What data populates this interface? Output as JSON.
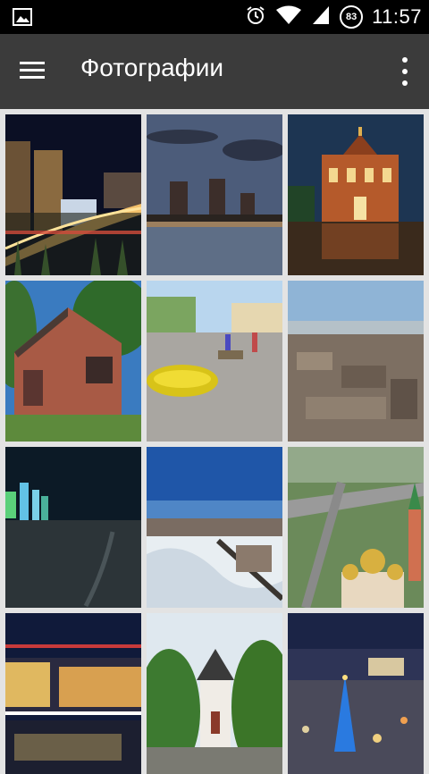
{
  "status_bar": {
    "time": "11:57",
    "battery_level": "83",
    "icons": [
      "gallery-notification-icon",
      "alarm-icon",
      "wifi-icon",
      "signal-icon",
      "battery-icon"
    ]
  },
  "toolbar": {
    "title": "Фотографии",
    "menu_icon": "menu-icon",
    "more_icon": "more-vert-icon"
  },
  "photos": [
    {
      "scene": "night-city-street"
    },
    {
      "scene": "river-skyline-dusk"
    },
    {
      "scene": "church-night-reflection"
    },
    {
      "scene": "old-brick-house"
    },
    {
      "scene": "pedestrian-street-flowers"
    },
    {
      "scene": "aerial-city-view"
    },
    {
      "scene": "winter-night-towers"
    },
    {
      "scene": "winter-aerial-bridge"
    },
    {
      "scene": "aerial-cathedral"
    },
    {
      "scene": "night-street-lights"
    },
    {
      "scene": "chapel-park"
    },
    {
      "scene": "christmas-square-night"
    }
  ]
}
